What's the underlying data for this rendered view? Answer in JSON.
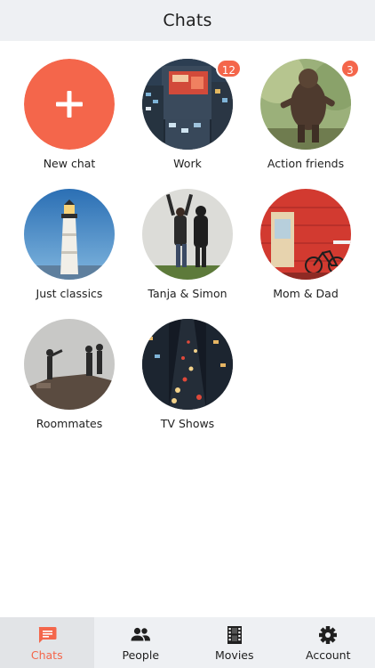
{
  "header": {
    "title": "Chats"
  },
  "colors": {
    "accent": "#f4664b",
    "bar_bg": "#eef0f3"
  },
  "chats": [
    {
      "label": "New chat",
      "badge": null,
      "icon": "plus-icon"
    },
    {
      "label": "Work",
      "badge": "12"
    },
    {
      "label": "Action friends",
      "badge": "3"
    },
    {
      "label": "Just classics",
      "badge": null
    },
    {
      "label": "Tanja & Simon",
      "badge": null
    },
    {
      "label": "Mom & Dad",
      "badge": null
    },
    {
      "label": "Roommates",
      "badge": null
    },
    {
      "label": "TV Shows",
      "badge": null
    }
  ],
  "tabs": [
    {
      "label": "Chats",
      "icon": "chat-bubble-icon",
      "active": true
    },
    {
      "label": "People",
      "icon": "people-icon",
      "active": false
    },
    {
      "label": "Movies",
      "icon": "film-icon",
      "active": false
    },
    {
      "label": "Account",
      "icon": "gear-icon",
      "active": false
    }
  ]
}
